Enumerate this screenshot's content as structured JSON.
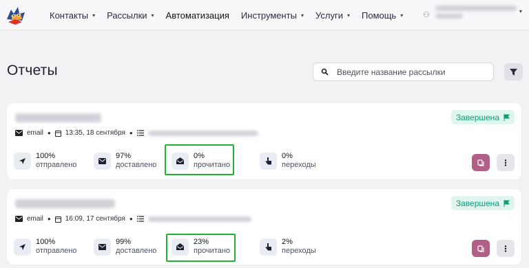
{
  "nav": {
    "items": [
      {
        "label": "Контакты",
        "caret": "▾"
      },
      {
        "label": "Рассылки",
        "caret": "▾"
      },
      {
        "label": "Автоматизация",
        "caret": ""
      },
      {
        "label": "Инструменты",
        "caret": "▾"
      },
      {
        "label": "Услуги",
        "caret": "▾"
      },
      {
        "label": "Помощь",
        "caret": "▾"
      }
    ],
    "user_caret": "▾"
  },
  "page": {
    "title": "Отчеты",
    "search_placeholder": "Введите название рассылки"
  },
  "colors": {
    "accent_green": "#0d9e75",
    "highlight_green": "#1eb52e",
    "action_purple": "#b15f88"
  },
  "reports": [
    {
      "status": "Завершена",
      "channel": "email",
      "datetime": "13:35, 18 сентября",
      "stats": [
        {
          "value": "100%",
          "label": "отправлено",
          "icon": "send-icon"
        },
        {
          "value": "97%",
          "label": "доставлено",
          "icon": "envelope-icon"
        },
        {
          "value": "0%",
          "label": "прочитано",
          "icon": "open-envelope-icon"
        },
        {
          "value": "0%",
          "label": "переходы",
          "icon": "pointer-hand-icon"
        }
      ]
    },
    {
      "status": "Завершена",
      "channel": "email",
      "datetime": "16:09, 17 сентября",
      "stats": [
        {
          "value": "100%",
          "label": "отправлено",
          "icon": "send-icon"
        },
        {
          "value": "99%",
          "label": "доставлено",
          "icon": "envelope-icon"
        },
        {
          "value": "23%",
          "label": "прочитано",
          "icon": "open-envelope-icon"
        },
        {
          "value": "2%",
          "label": "переходы",
          "icon": "pointer-hand-icon"
        }
      ]
    }
  ]
}
